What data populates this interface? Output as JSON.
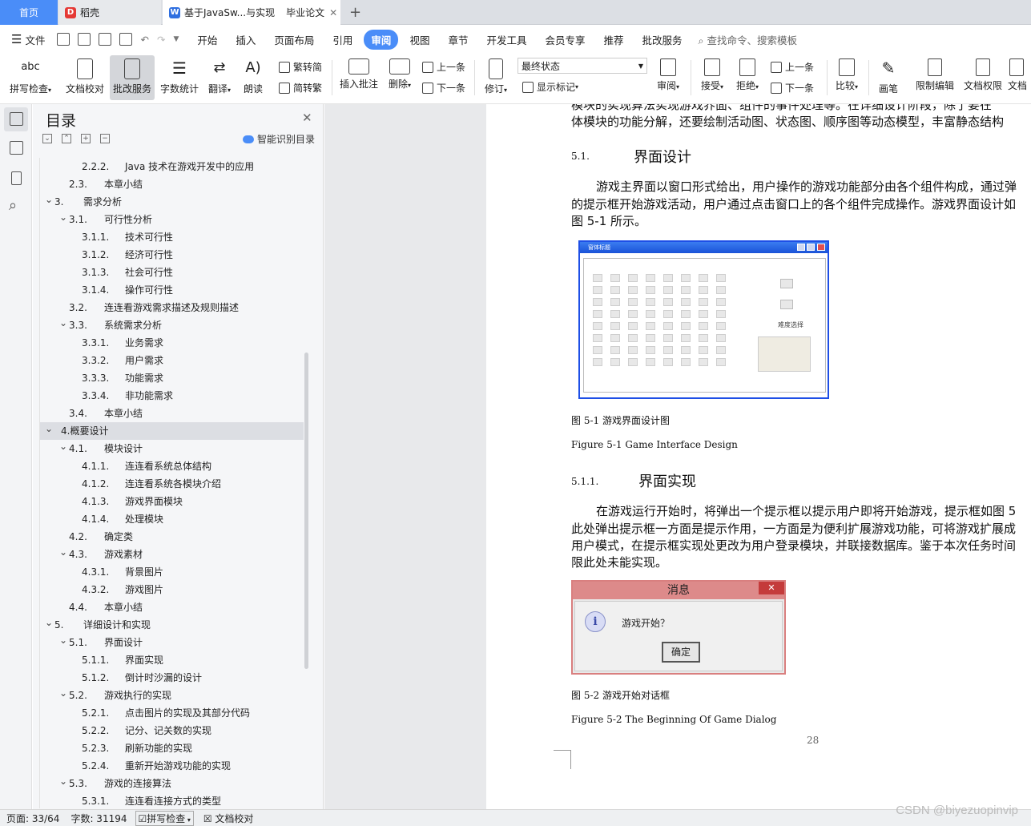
{
  "tabs": {
    "home": "首页",
    "docker": "稻壳",
    "doc": "基于JavaSw...与实现",
    "doc2": "毕业论文"
  },
  "menu": {
    "file": "文件",
    "items": [
      "开始",
      "插入",
      "页面布局",
      "引用",
      "审阅",
      "视图",
      "章节",
      "开发工具",
      "会员专享",
      "推荐",
      "批改服务"
    ],
    "active": "审阅",
    "search": "查找命令、搜索模板"
  },
  "ribbon": {
    "spell": "拼写检查",
    "proof": "文档校对",
    "grading": "批改服务",
    "wordcount": "字数统计",
    "translate": "翻译",
    "read": "朗读",
    "to_trad": "繁转简",
    "to_simp": "简转繁",
    "insert_comment": "插入批注",
    "delete": "删除",
    "prev": "上一条",
    "next": "下一条",
    "track": "修订",
    "final_state": "最终状态",
    "show_marks": "显示标记",
    "review": "审阅",
    "accept": "接受",
    "reject": "拒绝",
    "prev2": "上一条",
    "next2": "下一条",
    "compare": "比较",
    "pen": "画笔",
    "restrict": "限制编辑",
    "doc_rights": "文档权限",
    "doc_more": "文档"
  },
  "toc": {
    "title": "目录",
    "smart": "智能识别目录",
    "items": [
      {
        "num": "2.2.2.",
        "label": "Java 技术在游戏开发中的应用",
        "lvl": 3
      },
      {
        "num": "2.3.",
        "label": "本章小结",
        "lvl": 2
      },
      {
        "num": "3.",
        "label": "需求分析",
        "lvl": 1,
        "exp": true
      },
      {
        "num": "3.1.",
        "label": "可行性分析",
        "lvl": 2,
        "exp": true
      },
      {
        "num": "3.1.1.",
        "label": "技术可行性",
        "lvl": 3
      },
      {
        "num": "3.1.2.",
        "label": "经济可行性",
        "lvl": 3
      },
      {
        "num": "3.1.3.",
        "label": "社会可行性",
        "lvl": 3
      },
      {
        "num": "3.1.4.",
        "label": "操作可行性",
        "lvl": 3
      },
      {
        "num": "3.2.",
        "label": "连连看游戏需求描述及规则描述",
        "lvl": 2
      },
      {
        "num": "3.3.",
        "label": "系统需求分析",
        "lvl": 2,
        "exp": true
      },
      {
        "num": "3.3.1.",
        "label": "业务需求",
        "lvl": 3
      },
      {
        "num": "3.3.2.",
        "label": "用户需求",
        "lvl": 3
      },
      {
        "num": "3.3.3.",
        "label": "功能需求",
        "lvl": 3
      },
      {
        "num": "3.3.4.",
        "label": "非功能需求",
        "lvl": 3
      },
      {
        "num": "3.4.",
        "label": "本章小结",
        "lvl": 2
      },
      {
        "num": "4.",
        "label": "概要设计",
        "lvl": 1,
        "exp": true,
        "sel": true
      },
      {
        "num": "4.1.",
        "label": "模块设计",
        "lvl": 2,
        "exp": true
      },
      {
        "num": "4.1.1.",
        "label": "连连看系统总体结构",
        "lvl": 3
      },
      {
        "num": "4.1.2.",
        "label": "连连看系统各模块介绍",
        "lvl": 3
      },
      {
        "num": "4.1.3.",
        "label": "游戏界面模块",
        "lvl": 3
      },
      {
        "num": "4.1.4.",
        "label": "处理模块",
        "lvl": 3
      },
      {
        "num": "4.2.",
        "label": "确定类",
        "lvl": 2
      },
      {
        "num": "4.3.",
        "label": "游戏素材",
        "lvl": 2,
        "exp": true
      },
      {
        "num": "4.3.1.",
        "label": "背景图片",
        "lvl": 3
      },
      {
        "num": "4.3.2.",
        "label": "游戏图片",
        "lvl": 3
      },
      {
        "num": "4.4.",
        "label": "本章小结",
        "lvl": 2
      },
      {
        "num": "5.",
        "label": "详细设计和实现",
        "lvl": 1,
        "exp": true
      },
      {
        "num": "5.1.",
        "label": "界面设计",
        "lvl": 2,
        "exp": true
      },
      {
        "num": "5.1.1.",
        "label": "界面实现",
        "lvl": 3
      },
      {
        "num": "5.1.2.",
        "label": "倒计时沙漏的设计",
        "lvl": 3
      },
      {
        "num": "5.2.",
        "label": "游戏执行的实现",
        "lvl": 2,
        "exp": true
      },
      {
        "num": "5.2.1.",
        "label": "点击图片的实现及其部分代码",
        "lvl": 3
      },
      {
        "num": "5.2.2.",
        "label": "记分、记关数的实现",
        "lvl": 3
      },
      {
        "num": "5.2.3.",
        "label": "刷新功能的实现",
        "lvl": 3
      },
      {
        "num": "5.2.4.",
        "label": "重新开始游戏功能的实现",
        "lvl": 3
      },
      {
        "num": "5.3.",
        "label": "游戏的连接算法",
        "lvl": 2,
        "exp": true
      },
      {
        "num": "5.3.1.",
        "label": "连连看连接方式的类型",
        "lvl": 3
      }
    ]
  },
  "page": {
    "line0": "模块的实现算法实现游戏界面、组件的事件处理等。在详细设计阶段，除了要在",
    "line1": "体模块的功能分解，还要绘制活动图、状态图、顺序图等动态模型，丰富静态结构",
    "sec51_num": "5.1.",
    "sec51_title": "界面设计",
    "p1a": "游戏主界面以窗口形式给出，用户操作的游戏功能部分由各个组件构成，通过弹",
    "p1b": "的提示框开始游戏活动，用户通过点击窗口上的各个组件完成操作。游戏界面设计如",
    "p1c": "图 5-1 所示。",
    "fig1_window_title": "窗体标题",
    "fig1_combo": "难度选择",
    "cap1_cn": "图  5-1    游戏界面设计图",
    "cap1_en": "Figure 5-1    Game Interface Design",
    "sec511_num": "5.1.1.",
    "sec511_title": "界面实现",
    "p2a": "在游戏运行开始时，将弹出一个提示框以提示用户即将开始游戏，提示框如图 5",
    "p2b": "此处弹出提示框一方面是提示作用，一方面是为便利扩展游戏功能，可将游戏扩展成",
    "p2c": "用户模式，在提示框实现处更改为用户登录模块，并联接数据库。鉴于本次任务时间",
    "p2d": "限此处未能实现。",
    "dlg_title": "消息",
    "dlg_close": "✕",
    "dlg_msg": "游戏开始？",
    "dlg_ok": "确定",
    "dlg_info": "i",
    "cap2_cn": "图  5-2    游戏开始对话框",
    "cap2_en": "Figure 5-2    The Beginning Of Game Dialog",
    "page_no": "28"
  },
  "status": {
    "page": "页面: 33/64",
    "words": "字数: 31194",
    "spell": "拼写检查",
    "proof": "文档校对"
  },
  "watermark": "CSDN @biyezuopinvip"
}
